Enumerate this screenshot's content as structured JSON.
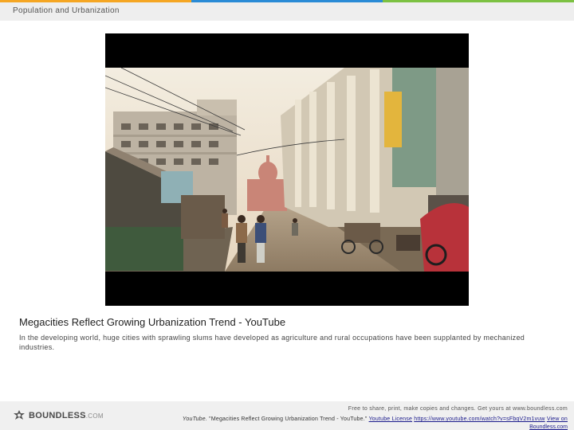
{
  "header": {
    "title": "Population and Urbanization",
    "accent_colors": [
      "#f5a623",
      "#2a8bd6",
      "#7cc142"
    ]
  },
  "video": {
    "content": "Busy city street with multi-storey buildings, pedestrians and rickshaws"
  },
  "caption": {
    "title": "Megacities Reflect Growing Urbanization Trend - YouTube",
    "description": "In the developing world, huge cities with sprawling slums have developed as agriculture and rural occupations have been supplanted by mechanized industries."
  },
  "footer": {
    "logo_text": "BOUNDLESS",
    "logo_suffix": ".COM",
    "license_note": "Free to share, print, make copies and changes. Get yours at www.boundless.com",
    "source_site": "YouTube.",
    "source_quote": " \"Megacities Reflect Growing Urbanization Trend - YouTube.\" ",
    "license_link": "Youtube License",
    "separator1": " ",
    "video_url": "https://www.youtube.com/watch?v=sFbqV2m1vuw",
    "separator2": " ",
    "view_on_label": "View on",
    "view_on_site": "Boundless.com"
  }
}
